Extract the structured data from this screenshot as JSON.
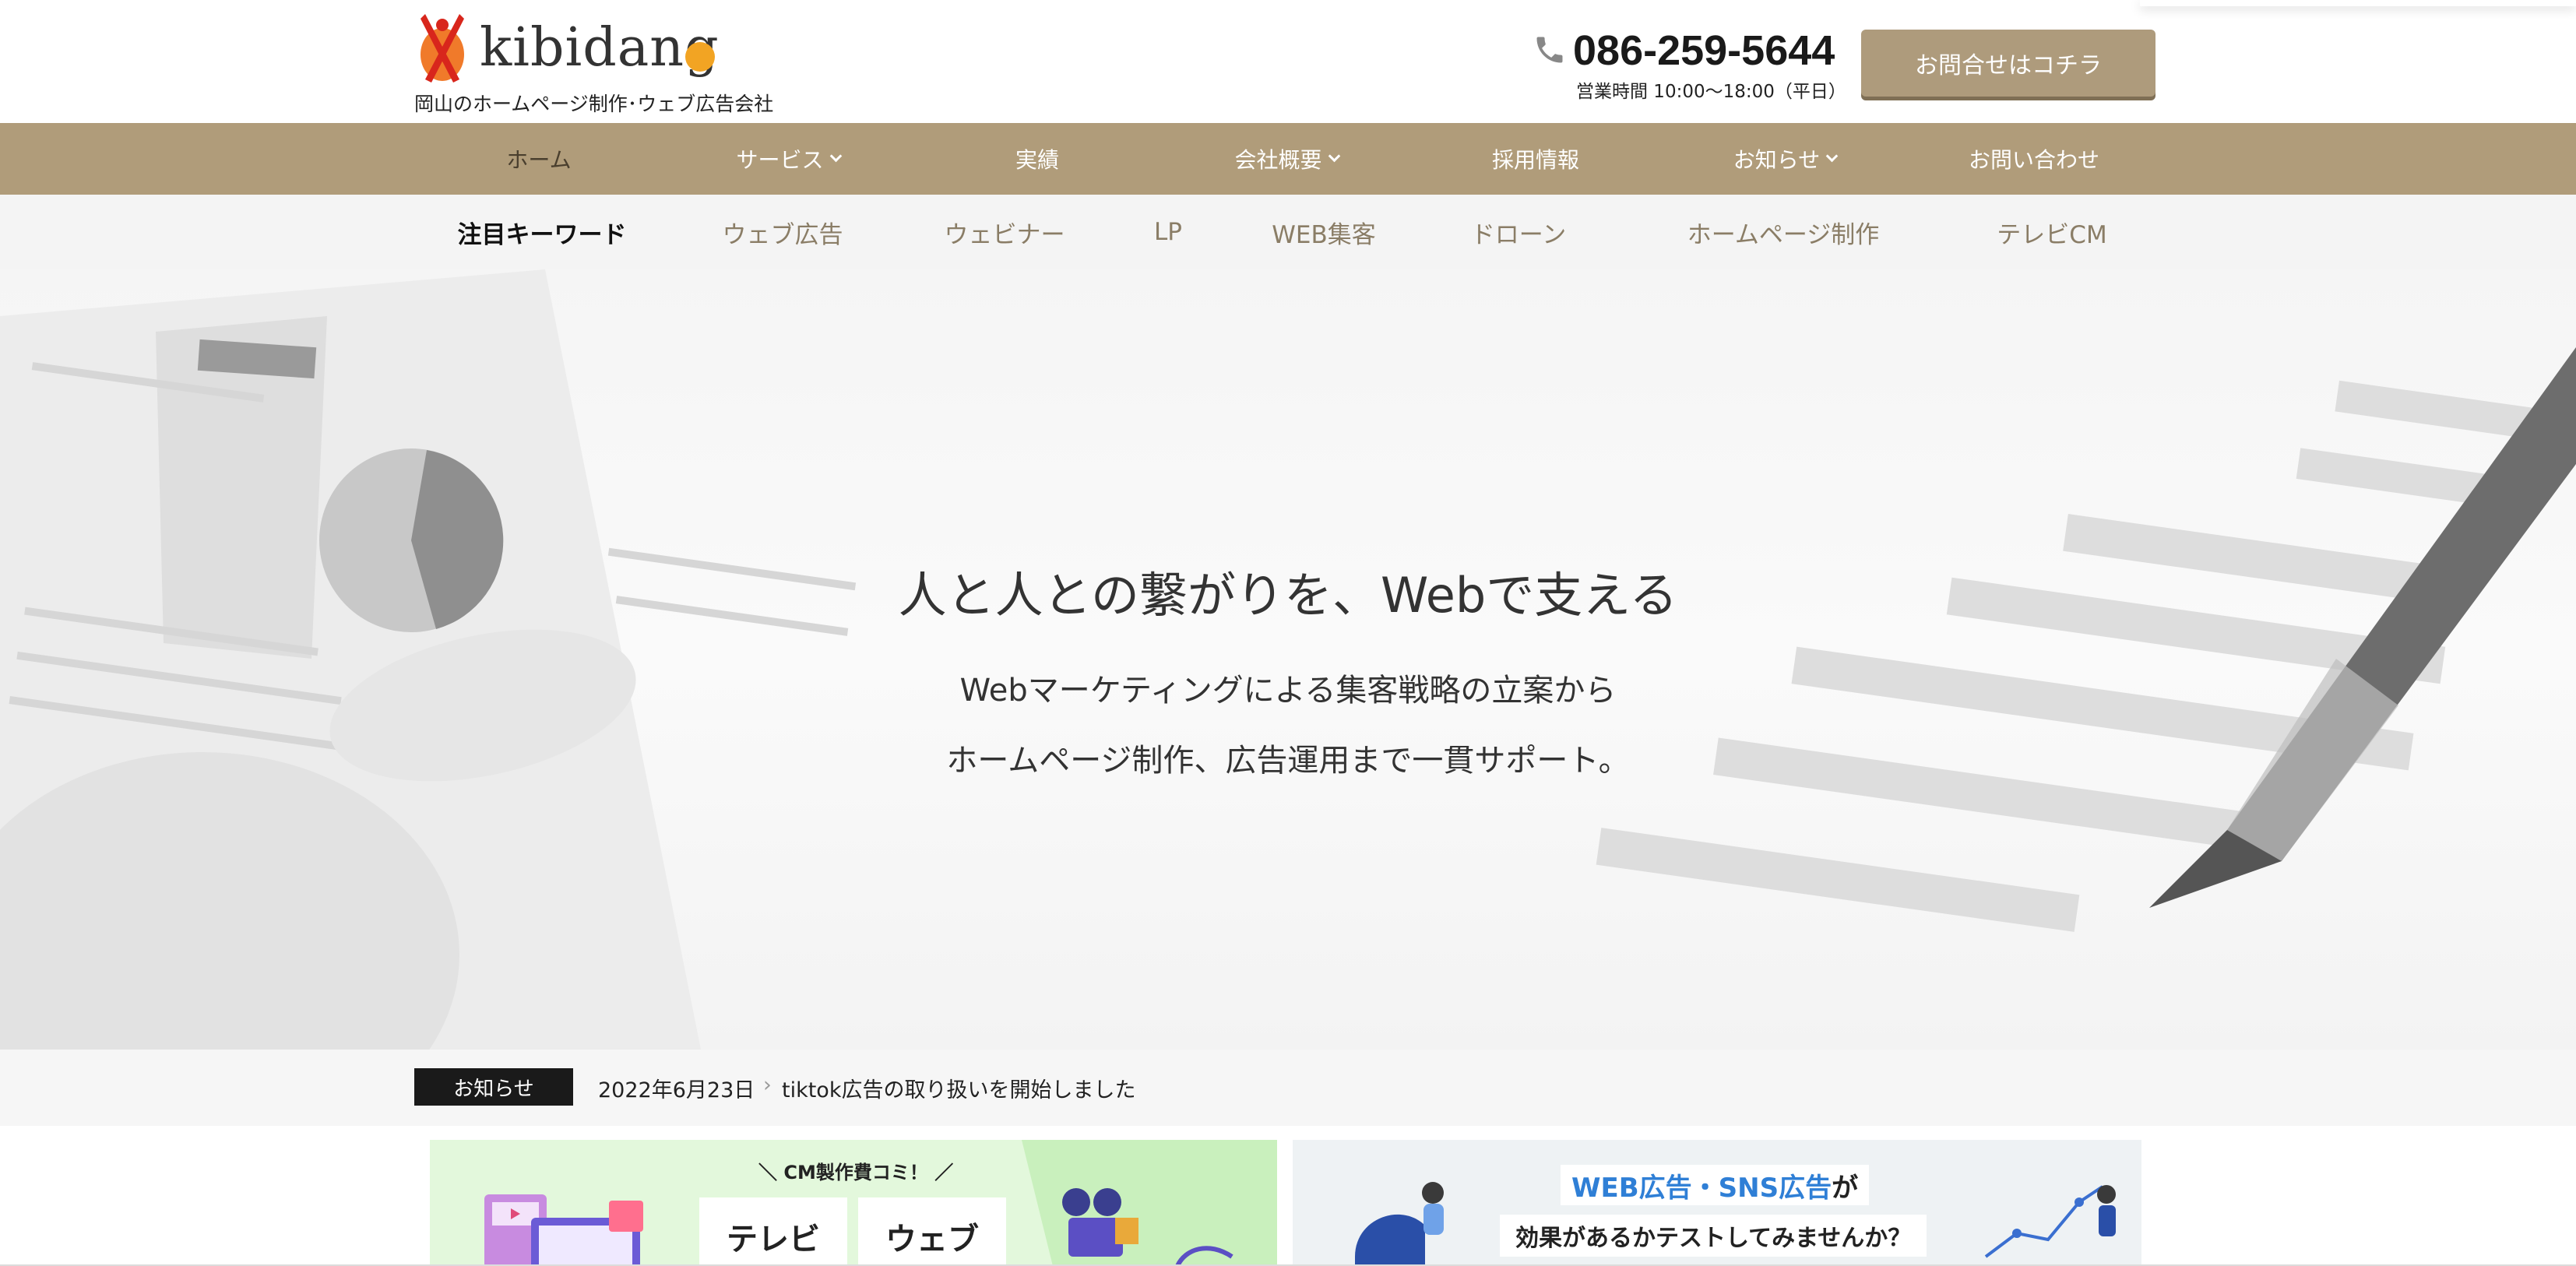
{
  "header": {
    "logo_text": "kibidang",
    "tagline": "岡山のホームページ制作･ウェブ広告会社",
    "phone": "086-259-5644",
    "hours": "営業時間 10:00〜18:00（平日）",
    "contact_button": "お問合せはコチラ",
    "icons": [
      "phone-icon"
    ]
  },
  "main_nav": {
    "items": [
      {
        "label": "ホーム",
        "active": true
      },
      {
        "label": "サービス",
        "dropdown": true
      },
      {
        "label": "実績"
      },
      {
        "label": "会社概要",
        "dropdown": true
      },
      {
        "label": "採用情報"
      },
      {
        "label": "お知らせ",
        "dropdown": true
      },
      {
        "label": "お問い合わせ"
      }
    ]
  },
  "keywords": {
    "heading": "注目キーワード",
    "items": [
      "ウェブ広告",
      "ウェビナー",
      "LP",
      "WEB集客",
      "ドローン",
      "ホームページ制作",
      "テレビCM"
    ]
  },
  "hero": {
    "title": "人と人との繋がりを、Webで支える",
    "subtitle_line1": "Webマーケティングによる集客戦略の立案から",
    "subtitle_line2": "ホームページ制作、広告運用まで一貫サポート。"
  },
  "news": {
    "label": "お知らせ",
    "date": "2022年6月23日",
    "arrow": "›",
    "text": "tiktok広告の取り扱いを開始しました"
  },
  "banners": {
    "cm": {
      "heading": "＼ CM製作費コミ！ ／",
      "tile1": "テレビ",
      "tile2": "ウェブ"
    },
    "web_ads": {
      "highlight": "WEB広告・SNS広告",
      "highlight_suffix": "が",
      "line2": "効果があるかテストしてみませんか？"
    }
  },
  "colors": {
    "nav_bg": "#b09c7a",
    "button_bg": "#ae9b7c",
    "logo_dot": "#f2a423",
    "logo_mark": "#e8502a",
    "news_label_bg": "#1a1a1a",
    "banner_green": "#e3f8dc",
    "banner_blue_text": "#2f7fd6"
  }
}
